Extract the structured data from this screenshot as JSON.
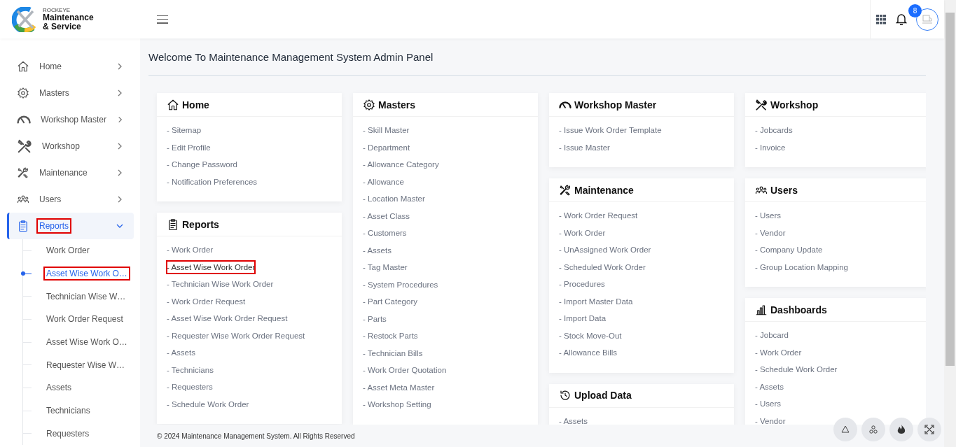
{
  "brand": {
    "company": "ROCKEYE",
    "name_line1": "Maintenance",
    "name_line2": "& Service"
  },
  "header": {
    "notification_count": "8"
  },
  "sidebar": {
    "items": [
      {
        "label": "Home",
        "expanded": false,
        "selected": false,
        "highlighted": false
      },
      {
        "label": "Masters",
        "expanded": false,
        "selected": false,
        "highlighted": false
      },
      {
        "label": "Workshop Master",
        "expanded": false,
        "selected": false,
        "highlighted": false
      },
      {
        "label": "Workshop",
        "expanded": false,
        "selected": false,
        "highlighted": false
      },
      {
        "label": "Maintenance",
        "expanded": false,
        "selected": false,
        "highlighted": false
      },
      {
        "label": "Users",
        "expanded": false,
        "selected": false,
        "highlighted": false
      },
      {
        "label": "Reports",
        "expanded": true,
        "selected": true,
        "highlighted": true,
        "children": [
          {
            "label": "Work Order",
            "selected": false,
            "highlighted": false
          },
          {
            "label": "Asset Wise Work O…",
            "selected": true,
            "highlighted": true
          },
          {
            "label": "Technician Wise W…",
            "selected": false,
            "highlighted": false
          },
          {
            "label": "Work Order Request",
            "selected": false,
            "highlighted": false
          },
          {
            "label": "Asset Wise Work O…",
            "selected": false,
            "highlighted": false
          },
          {
            "label": "Requester Wise W…",
            "selected": false,
            "highlighted": false
          },
          {
            "label": "Assets",
            "selected": false,
            "highlighted": false
          },
          {
            "label": "Technicians",
            "selected": false,
            "highlighted": false
          },
          {
            "label": "Requesters",
            "selected": false,
            "highlighted": false
          }
        ]
      }
    ]
  },
  "page_title": "Welcome To Maintenance Management System Admin Panel",
  "columns": [
    [
      {
        "title": "Home",
        "links": [
          {
            "label": "- Sitemap",
            "highlighted": false
          },
          {
            "label": "- Edit Profile",
            "highlighted": false
          },
          {
            "label": "- Change Password",
            "highlighted": false
          },
          {
            "label": "- Notification Preferences",
            "highlighted": false
          }
        ]
      },
      {
        "title": "Reports",
        "links": [
          {
            "label": "- Work Order",
            "highlighted": false
          },
          {
            "label": "- Asset Wise Work Order",
            "highlighted": true
          },
          {
            "label": "- Technician Wise Work Order",
            "highlighted": false
          },
          {
            "label": "- Work Order Request",
            "highlighted": false
          },
          {
            "label": "- Asset Wise Work Order Request",
            "highlighted": false
          },
          {
            "label": "- Requester Wise Work Order Request",
            "highlighted": false
          },
          {
            "label": "- Assets",
            "highlighted": false
          },
          {
            "label": "- Technicians",
            "highlighted": false
          },
          {
            "label": "- Requesters",
            "highlighted": false
          },
          {
            "label": "- Schedule Work Order",
            "highlighted": false
          }
        ]
      }
    ],
    [
      {
        "title": "Masters",
        "links": [
          {
            "label": "- Skill Master",
            "highlighted": false
          },
          {
            "label": "- Department",
            "highlighted": false
          },
          {
            "label": "- Allowance Category",
            "highlighted": false
          },
          {
            "label": "- Allowance",
            "highlighted": false
          },
          {
            "label": "- Location Master",
            "highlighted": false
          },
          {
            "label": "- Asset Class",
            "highlighted": false
          },
          {
            "label": "- Customers",
            "highlighted": false
          },
          {
            "label": "- Assets",
            "highlighted": false
          },
          {
            "label": "- Tag Master",
            "highlighted": false
          },
          {
            "label": "- System Procedures",
            "highlighted": false
          },
          {
            "label": "- Part Category",
            "highlighted": false
          },
          {
            "label": "- Parts",
            "highlighted": false
          },
          {
            "label": "- Restock Parts",
            "highlighted": false
          },
          {
            "label": "- Technician Bills",
            "highlighted": false
          },
          {
            "label": "- Work Order Quotation",
            "highlighted": false
          },
          {
            "label": "- Asset Meta Master",
            "highlighted": false
          },
          {
            "label": "- Workshop Setting",
            "highlighted": false
          }
        ]
      }
    ],
    [
      {
        "title": "Workshop Master",
        "links": [
          {
            "label": "- Issue Work Order Template",
            "highlighted": false
          },
          {
            "label": "- Issue Master",
            "highlighted": false
          }
        ]
      },
      {
        "title": "Maintenance",
        "links": [
          {
            "label": "- Work Order Request",
            "highlighted": false
          },
          {
            "label": "- Work Order",
            "highlighted": false
          },
          {
            "label": "- UnAssigned Work Order",
            "highlighted": false
          },
          {
            "label": "- Scheduled Work Order",
            "highlighted": false
          },
          {
            "label": "- Procedures",
            "highlighted": false
          },
          {
            "label": "- Import Master Data",
            "highlighted": false
          },
          {
            "label": "- Import Data",
            "highlighted": false
          },
          {
            "label": "- Stock Move-Out",
            "highlighted": false
          },
          {
            "label": "- Allowance Bills",
            "highlighted": false
          }
        ]
      },
      {
        "title": "Upload Data",
        "links": [
          {
            "label": "- Assets",
            "highlighted": false
          }
        ]
      }
    ],
    [
      {
        "title": "Workshop",
        "links": [
          {
            "label": "- Jobcards",
            "highlighted": false
          },
          {
            "label": "- Invoice",
            "highlighted": false
          }
        ]
      },
      {
        "title": "Users",
        "links": [
          {
            "label": "- Users",
            "highlighted": false
          },
          {
            "label": "- Vendor",
            "highlighted": false
          },
          {
            "label": "- Company Update",
            "highlighted": false
          },
          {
            "label": "- Group Location Mapping",
            "highlighted": false
          }
        ]
      },
      {
        "title": "Dashboards",
        "links": [
          {
            "label": "- Jobcard",
            "highlighted": false
          },
          {
            "label": "- Work Order",
            "highlighted": false
          },
          {
            "label": "- Schedule Work Order",
            "highlighted": false
          },
          {
            "label": "- Assets",
            "highlighted": false
          },
          {
            "label": "- Users",
            "highlighted": false
          },
          {
            "label": "- Vendor",
            "highlighted": false
          }
        ]
      }
    ]
  ],
  "footer": "© 2024 Maintenance Management System. All Rights Reserved"
}
